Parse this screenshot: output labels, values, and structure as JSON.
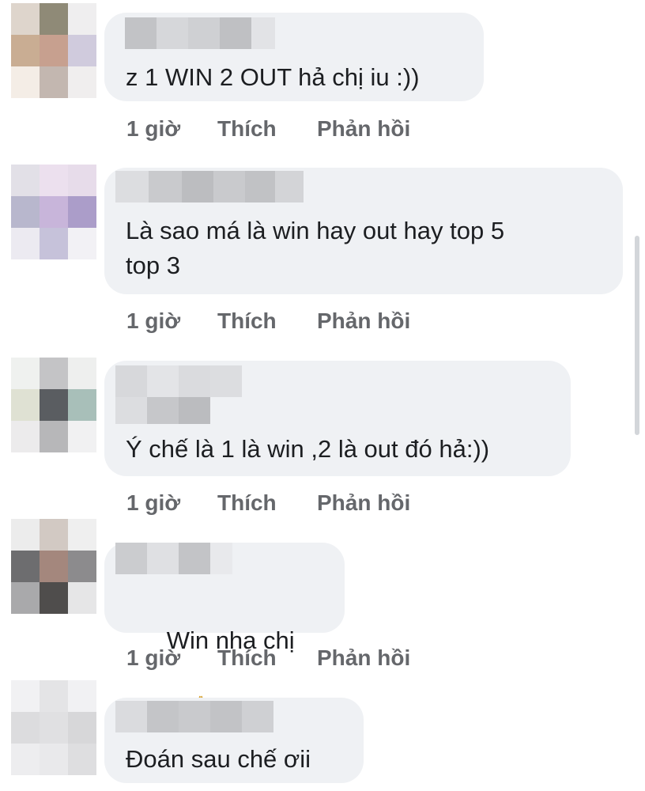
{
  "comments": [
    {
      "text": "z 1 WIN 2 OUT hả chị iu :))",
      "time": "1 giờ",
      "like": "Thích",
      "reply": "Phản hồi"
    },
    {
      "text": "Là sao má là win hay out hay top 5\ntop 3",
      "time": "1 giờ",
      "like": "Thích",
      "reply": "Phản hồi"
    },
    {
      "text": "Ý chế là 1 là win ,2 là out đó hả:))",
      "time": "1 giờ",
      "like": "Thích",
      "reply": "Phản hồi"
    },
    {
      "text": "Win nha chị",
      "emoji": "folded-hands-icon",
      "time": "1 giờ",
      "like": "Thích",
      "reply": "Phản hồi"
    },
    {
      "text": "Đoán sau chế ơii"
    }
  ],
  "colors": {
    "bubble": "#eff1f4",
    "meta_text": "#65676b",
    "comment_text": "#1c1e21"
  }
}
